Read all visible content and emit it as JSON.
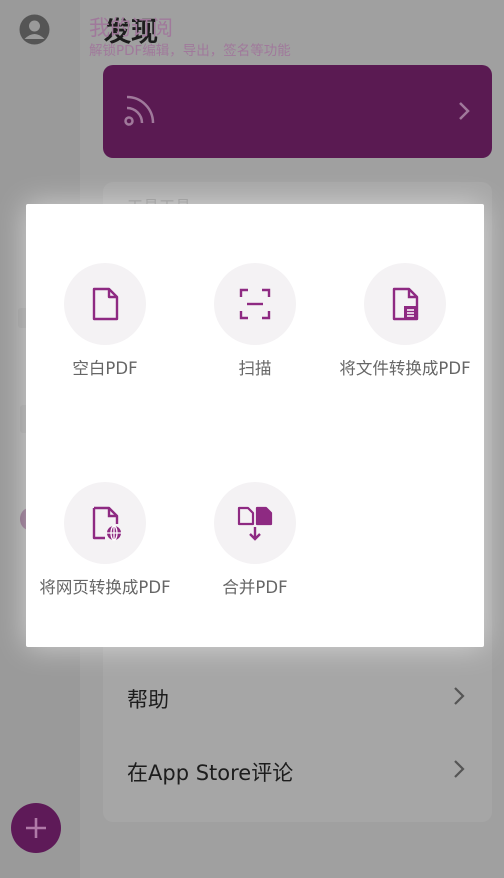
{
  "header": {
    "title": "发现"
  },
  "subscription": {
    "title": "我的订阅",
    "description": "解锁PDF编辑，导出，签名等功能"
  },
  "tools": {
    "section_label": "工具工具"
  },
  "rows": [
    {
      "label": "帮助"
    },
    {
      "label": "在App Store评论"
    }
  ],
  "dialog": {
    "actions": [
      {
        "label": "空白PDF",
        "icon": "blank-page-icon"
      },
      {
        "label": "扫描",
        "icon": "scan-icon"
      },
      {
        "label": "将文件转换成PDF",
        "icon": "file-convert-icon"
      },
      {
        "label": "将网页转换成PDF",
        "icon": "web-convert-icon"
      },
      {
        "label": "合并PDF",
        "icon": "merge-icon"
      }
    ]
  },
  "colors": {
    "accent": "#8e2a82",
    "accent_dark": "#5e1a58",
    "dialog_bg": "#ffffff"
  }
}
